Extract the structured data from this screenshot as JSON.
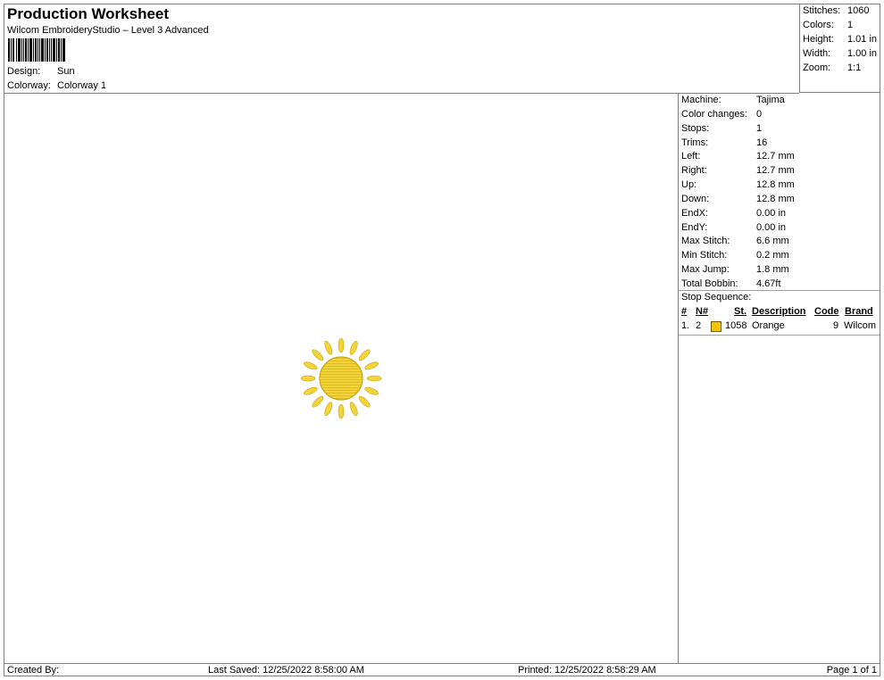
{
  "header": {
    "title": "Production Worksheet",
    "subtitle": "Wilcom EmbroideryStudio – Level 3 Advanced",
    "design_label": "Design:",
    "design_value": "Sun",
    "colorway_label": "Colorway:",
    "colorway_value": "Colorway 1"
  },
  "summary": [
    {
      "label": "Stitches:",
      "value": "1060"
    },
    {
      "label": "Colors:",
      "value": "1"
    },
    {
      "label": "Height:",
      "value": "1.01 in"
    },
    {
      "label": "Width:",
      "value": "1.00 in"
    },
    {
      "label": "Zoom:",
      "value": "1:1"
    }
  ],
  "properties": [
    {
      "label": "Machine:",
      "value": "Tajima"
    },
    {
      "label": "Color changes:",
      "value": "0"
    },
    {
      "label": "Stops:",
      "value": "1"
    },
    {
      "label": "Trims:",
      "value": "16"
    },
    {
      "label": "Left:",
      "value": "12.7 mm"
    },
    {
      "label": "Right:",
      "value": "12.7 mm"
    },
    {
      "label": "Up:",
      "value": "12.8 mm"
    },
    {
      "label": "Down:",
      "value": "12.8 mm"
    },
    {
      "label": "EndX:",
      "value": "0.00 in"
    },
    {
      "label": "EndY:",
      "value": "0.00 in"
    },
    {
      "label": "Max Stitch:",
      "value": "6.6 mm"
    },
    {
      "label": "Min Stitch:",
      "value": "0.2 mm"
    },
    {
      "label": "Max Jump:",
      "value": "1.8 mm"
    },
    {
      "label": "Total Bobbin:",
      "value": "4.67ft"
    }
  ],
  "stop_sequence": {
    "label": "Stop Sequence:",
    "headers": {
      "num": "#",
      "n": "N#",
      "st": "St.",
      "description": "Description",
      "code": "Code",
      "brand": "Brand"
    },
    "rows": [
      {
        "num": "1.",
        "n": "2",
        "color": "#F5C400",
        "st": "1058",
        "description": "Orange",
        "code": "9",
        "brand": "Wilcom"
      }
    ]
  },
  "footer": {
    "created_by": "Created By:",
    "last_saved": "Last Saved: 12/25/2022 8:58:00 AM",
    "printed": "Printed: 12/25/2022 8:58:29 AM",
    "page": "Page 1 of 1"
  },
  "design_color": "#F2D43A"
}
